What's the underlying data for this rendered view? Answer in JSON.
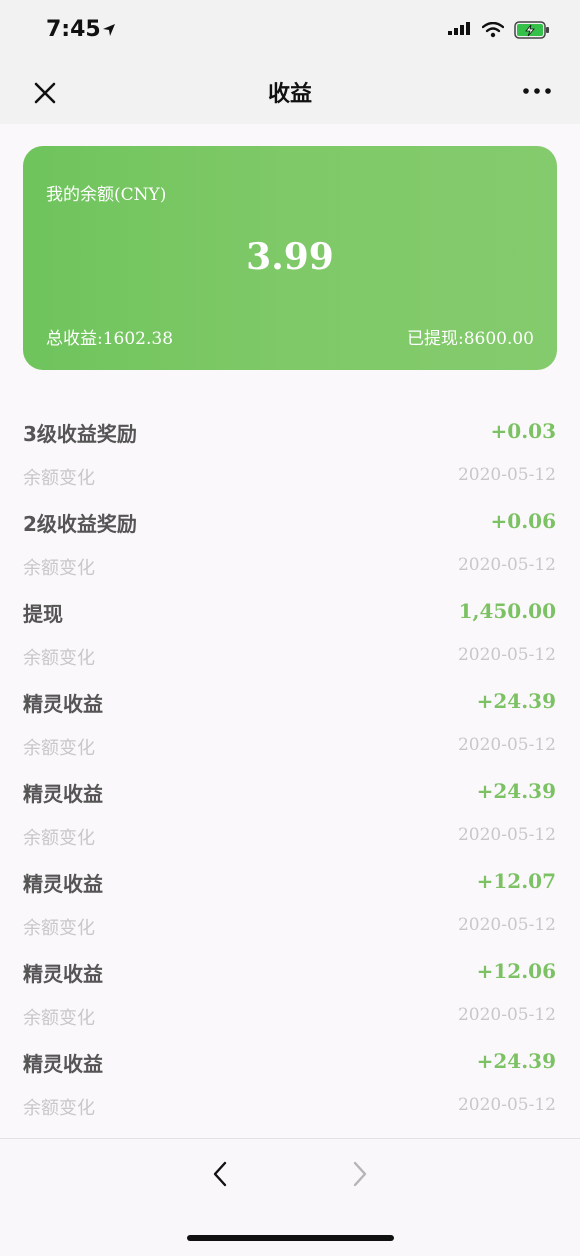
{
  "status_bar": {
    "time": "7:45"
  },
  "nav": {
    "title": "收益"
  },
  "card": {
    "label": "我的余额(CNY)",
    "balance": "3.99",
    "total_income": "总收益:1602.38",
    "withdrawn": "已提现:8600.00"
  },
  "records": [
    {
      "title": "3级收益奖励",
      "amount": "+0.03",
      "sub": "余额变化",
      "date": "2020-05-12"
    },
    {
      "title": "2级收益奖励",
      "amount": "+0.06",
      "sub": "余额变化",
      "date": "2020-05-12"
    },
    {
      "title": "提现",
      "amount": "1,450.00",
      "sub": "余额变化",
      "date": "2020-05-12"
    },
    {
      "title": "精灵收益",
      "amount": "+24.39",
      "sub": "余额变化",
      "date": "2020-05-12"
    },
    {
      "title": "精灵收益",
      "amount": "+24.39",
      "sub": "余额变化",
      "date": "2020-05-12"
    },
    {
      "title": "精灵收益",
      "amount": "+12.07",
      "sub": "余额变化",
      "date": "2020-05-12"
    },
    {
      "title": "精灵收益",
      "amount": "+12.06",
      "sub": "余额变化",
      "date": "2020-05-12"
    },
    {
      "title": "精灵收益",
      "amount": "+24.39",
      "sub": "余额变化",
      "date": "2020-05-12"
    }
  ],
  "icons": {
    "location": "location-arrow-icon",
    "signal": "signal-icon",
    "wifi": "wifi-icon",
    "battery": "battery-charging-icon",
    "close": "close-icon",
    "more": "more-icon",
    "back": "chevron-left-icon",
    "forward": "chevron-right-icon"
  },
  "colors": {
    "accent": "#7cc264",
    "card_start": "#6fc45c",
    "card_end": "#84cb6d"
  }
}
